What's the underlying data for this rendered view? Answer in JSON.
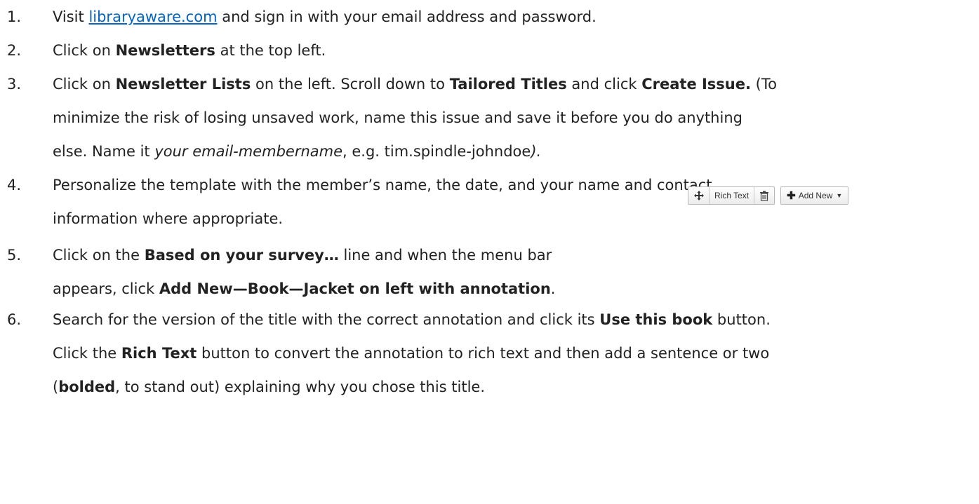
{
  "steps": [
    {
      "number": "1.",
      "lines": [
        [
          {
            "t": "Visit "
          },
          {
            "t": "libraryaware.com",
            "link": true
          },
          {
            "t": " and sign in with your email address and password."
          }
        ]
      ]
    },
    {
      "number": "2.",
      "lines": [
        [
          {
            "t": "Click on "
          },
          {
            "t": "Newsletters",
            "b": true
          },
          {
            "t": " at the top left."
          }
        ]
      ]
    },
    {
      "number": "3.",
      "lines": [
        [
          {
            "t": "Click on "
          },
          {
            "t": "Newsletter Lists",
            "b": true
          },
          {
            "t": " on the left.  Scroll down to "
          },
          {
            "t": "Tailored Titles",
            "b": true
          },
          {
            "t": " and click "
          },
          {
            "t": "Create Issue.",
            "b": true
          },
          {
            "t": " (To"
          }
        ],
        [
          {
            "t": "minimize the risk of losing unsaved work, name this issue and save it before you do anything"
          }
        ],
        [
          {
            "t": "else. Name it "
          },
          {
            "t": "your email-membername",
            "i": true
          },
          {
            "t": ", e.g. tim.spindle-johndoe"
          },
          {
            "t": ").",
            "i": true
          }
        ]
      ]
    },
    {
      "number": "4.",
      "lines": [
        [
          {
            "t": "Personalize the template with the member’s name, the date, and your name and contact"
          }
        ],
        [
          {
            "t": "information where appropriate."
          }
        ]
      ]
    },
    {
      "number": "5.",
      "lines": [
        [
          {
            "t": "Click on the "
          },
          {
            "t": "Based on your survey…",
            "b": true
          },
          {
            "t": " line and when the menu bar"
          }
        ],
        [
          {
            "t": "appears, click "
          },
          {
            "t": "Add New—Book—Jacket on left with annotation",
            "b": true
          },
          {
            "t": "."
          }
        ]
      ]
    },
    {
      "number": "6.",
      "lines": [
        [
          {
            "t": "Search for the version of the title with the correct annotation and click its "
          },
          {
            "t": "Use this book",
            "b": true
          },
          {
            "t": " button."
          }
        ],
        [
          {
            "t": "Click the "
          },
          {
            "t": "Rich Text",
            "b": true
          },
          {
            "t": " button to convert the annotation to rich text and then add a sentence or two"
          }
        ],
        [
          {
            "t": "("
          },
          {
            "t": "bolded",
            "b": true
          },
          {
            "t": ", to stand out) explaining why you chose this title."
          }
        ]
      ]
    }
  ],
  "toolbar": {
    "move_icon": "move-arrows-icon",
    "rich_text_label": "Rich Text",
    "trash_icon": "trash-icon",
    "add_new_label": "Add New",
    "plus_icon": "plus-icon",
    "caret_icon": "caret-down-icon"
  },
  "colors": {
    "text": "#222222",
    "link": "#0563c1"
  }
}
